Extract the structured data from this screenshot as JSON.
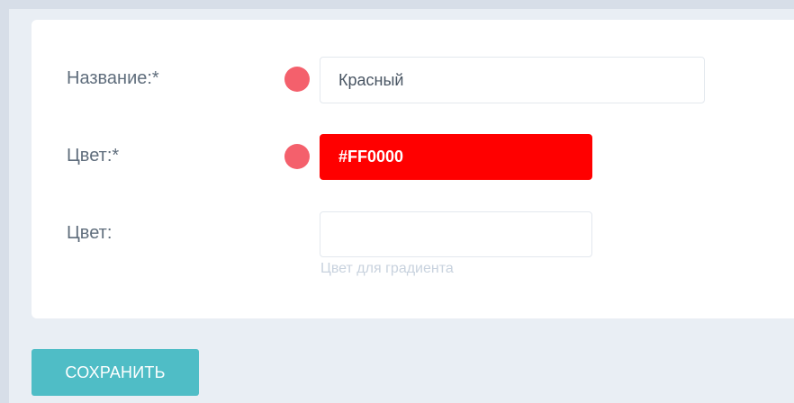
{
  "form": {
    "name_label": "Название:*",
    "name_value": "Красный",
    "color_label": "Цвет:*",
    "color_value": "#FF0000",
    "color2_label": "Цвет:",
    "color2_value": "",
    "color2_hint": "Цвет для градиента"
  },
  "actions": {
    "save_label": "СОХРАНИТЬ"
  },
  "colors": {
    "background": "#e9eef4",
    "card": "#ffffff",
    "required_marker": "#f4606c",
    "selected_color": "#ff0000",
    "save_button": "#4fbdc6"
  }
}
